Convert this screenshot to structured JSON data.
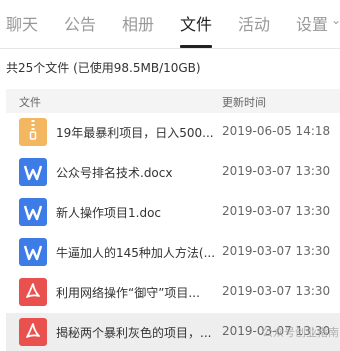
{
  "tabs": [
    {
      "label": "聊天"
    },
    {
      "label": "公告"
    },
    {
      "label": "相册"
    },
    {
      "label": "文件"
    },
    {
      "label": "活动"
    },
    {
      "label": "设置"
    }
  ],
  "active_tab": "文件",
  "settings_caret": "⌄",
  "summary": "共25个文件 (已使用98.5MB/10GB)",
  "table": {
    "col_file": "文件",
    "col_time": "更新时间"
  },
  "files": [
    {
      "name": "19年最暴利项目，日入500...",
      "time": "2019-06-05 14:18",
      "icon": "zip-icon"
    },
    {
      "name": "公众号排名技术.docx",
      "time": "2019-03-07 13:30",
      "icon": "word-icon"
    },
    {
      "name": "新人操作项目1.doc",
      "time": "2019-03-07 13:30",
      "icon": "word-icon"
    },
    {
      "name": "牛逼加人的145种加人方法(...",
      "time": "2019-03-07 13:30",
      "icon": "word-icon"
    },
    {
      "name": "利用网络操作“御守”项目...",
      "time": "2019-03-07 13:30",
      "icon": "pdf-icon"
    },
    {
      "name": "揭秘两个暴利灰色的项目，...",
      "time": "2019-03-07 13:30",
      "icon": "pdf-icon"
    }
  ],
  "colors": {
    "zip": "#f2b760",
    "word": "#3d7be6",
    "pdf": "#e8514d"
  },
  "watermark": "公众号创业指南"
}
